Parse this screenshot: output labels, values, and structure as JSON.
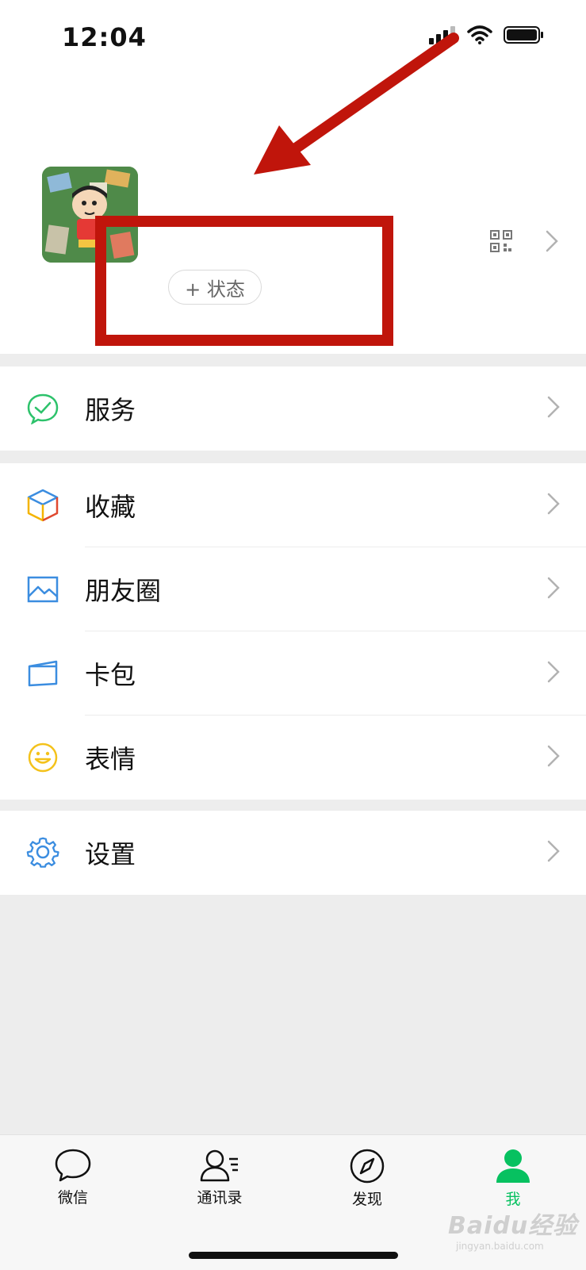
{
  "status_bar": {
    "time": "12:04"
  },
  "profile": {
    "status_button_label": "+ 状态"
  },
  "menu": {
    "services": {
      "label": "服务"
    },
    "favorites": {
      "label": "收藏"
    },
    "moments": {
      "label": "朋友圈"
    },
    "cards": {
      "label": "卡包"
    },
    "stickers": {
      "label": "表情"
    },
    "settings": {
      "label": "设置"
    }
  },
  "tabs": [
    {
      "label": "微信",
      "icon": "chat-bubble-icon"
    },
    {
      "label": "通讯录",
      "icon": "contacts-icon"
    },
    {
      "label": "发现",
      "icon": "compass-icon"
    },
    {
      "label": "我",
      "icon": "person-icon",
      "active": true
    }
  ],
  "watermark": {
    "brand": "Baidu经验",
    "url": "jingyan.baidu.com"
  },
  "colors": {
    "accent": "#07c160",
    "annotation": "#c0150b"
  }
}
